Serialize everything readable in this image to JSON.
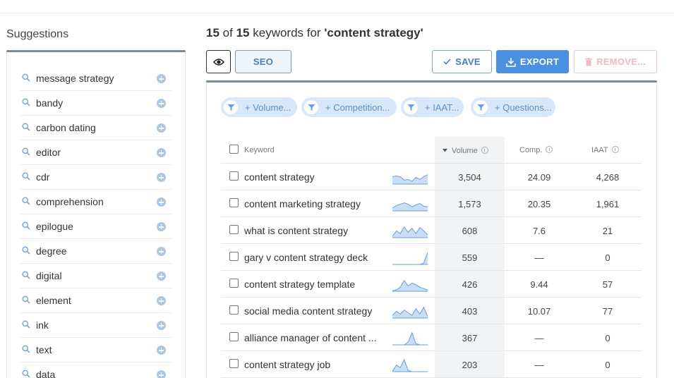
{
  "sidebar": {
    "title": "Suggestions",
    "items": [
      {
        "label": "message strategy"
      },
      {
        "label": "bandy"
      },
      {
        "label": "carbon dating"
      },
      {
        "label": "editor"
      },
      {
        "label": "cdr"
      },
      {
        "label": "comprehension"
      },
      {
        "label": "epilogue"
      },
      {
        "label": "degree"
      },
      {
        "label": "digital"
      },
      {
        "label": "element"
      },
      {
        "label": "ink"
      },
      {
        "label": "text"
      },
      {
        "label": "data"
      }
    ]
  },
  "header": {
    "shown": "15",
    "of_text": "of",
    "total": "15",
    "keywords_for": "keywords for",
    "query": "'content strategy'"
  },
  "toolbar": {
    "seo_label": "SEO",
    "save_label": "SAVE",
    "export_label": "EXPORT",
    "remove_label": "REMOVE..."
  },
  "filters": [
    {
      "label": "+ Volume..."
    },
    {
      "label": "+ Competition..."
    },
    {
      "label": "+ IAAT..."
    },
    {
      "label": "+ Questions..."
    }
  ],
  "table": {
    "columns": {
      "keyword": "Keyword",
      "volume": "Volume",
      "comp": "Comp.",
      "iaat": "IAAT"
    },
    "sort": {
      "column": "volume",
      "direction": "desc"
    },
    "rows": [
      {
        "keyword": "content strategy",
        "volume": "3,504",
        "comp": "24.09",
        "iaat": "4,268",
        "trend": [
          0.55,
          0.6,
          0.55,
          0.3,
          0.35,
          0.2,
          0.5,
          0.35,
          0.55,
          0.7
        ]
      },
      {
        "keyword": "content marketing strategy",
        "volume": "1,573",
        "comp": "20.35",
        "iaat": "1,961",
        "trend": [
          0.2,
          0.4,
          0.5,
          0.6,
          0.5,
          0.3,
          0.45,
          0.55,
          0.35,
          0.3
        ]
      },
      {
        "keyword": "what is content strategy",
        "volume": "608",
        "comp": "7.6",
        "iaat": "21",
        "trend": [
          0.1,
          0.5,
          0.3,
          0.8,
          0.4,
          0.7,
          0.3,
          0.75,
          0.5,
          0.2
        ]
      },
      {
        "keyword": "gary v content strategy deck",
        "volume": "559",
        "comp": "—",
        "iaat": "0",
        "trend": [
          0,
          0,
          0,
          0,
          0,
          0,
          0,
          0,
          0.1,
          0.9
        ]
      },
      {
        "keyword": "content strategy template",
        "volume": "426",
        "comp": "9.44",
        "iaat": "57",
        "trend": [
          0.05,
          0.1,
          0.3,
          0.8,
          0.4,
          0.6,
          0.5,
          0.3,
          0.2,
          0.1
        ]
      },
      {
        "keyword": "social media content strategy",
        "volume": "403",
        "comp": "10.07",
        "iaat": "77",
        "trend": [
          0.2,
          0.5,
          0.3,
          0.6,
          0.4,
          0.2,
          0.7,
          0.3,
          0.8,
          0.1
        ]
      },
      {
        "keyword": "alliance manager of content ...",
        "volume": "367",
        "comp": "—",
        "iaat": "0",
        "trend": [
          0,
          0,
          0,
          0,
          0.2,
          0.9,
          0.1,
          0,
          0,
          0
        ]
      },
      {
        "keyword": "content strategy job",
        "volume": "203",
        "comp": "—",
        "iaat": "0",
        "trend": [
          0,
          0.5,
          0.3,
          0.9,
          0.1,
          0,
          0,
          0,
          0,
          0
        ]
      }
    ]
  },
  "colors": {
    "accent": "#4a90e2",
    "spark_fill": "#c9ddf5",
    "spark_line": "#6a9fd8",
    "filter_bg": "#d8e8f8"
  }
}
